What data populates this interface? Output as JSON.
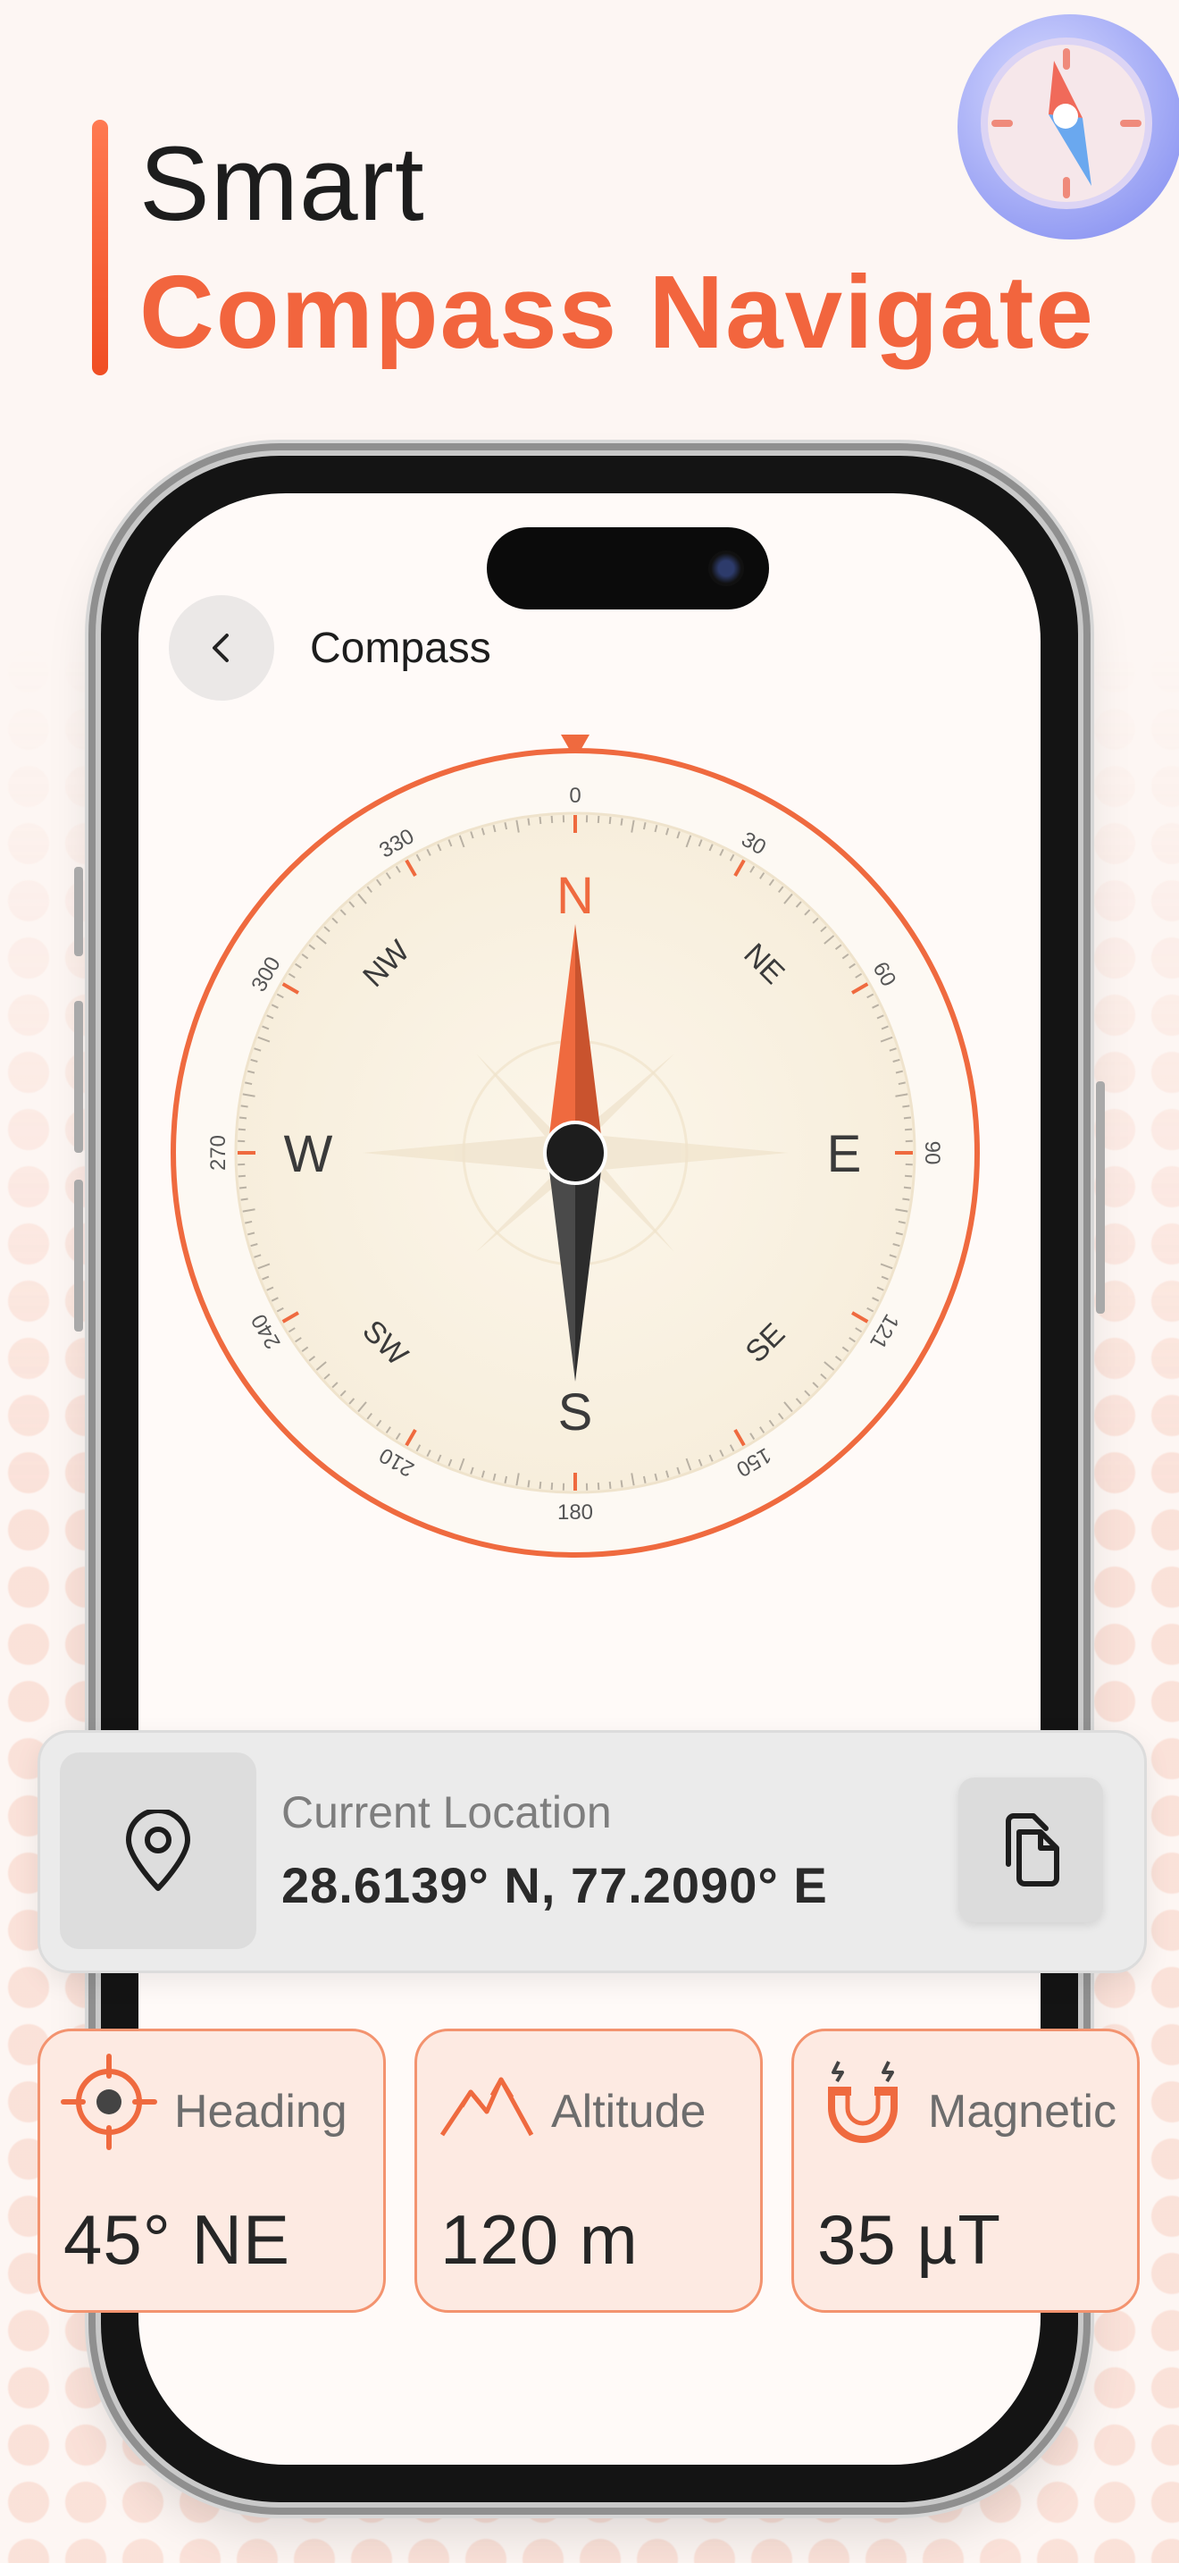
{
  "hero": {
    "line1": "Smart",
    "line2": "Compass Navigate"
  },
  "header": {
    "title": "Compass"
  },
  "compass": {
    "cardinals": {
      "n": "N",
      "e": "E",
      "s": "S",
      "w": "W"
    },
    "intercardinals": {
      "ne": "NE",
      "se": "SE",
      "sw": "SW",
      "nw": "NW"
    },
    "degree_labels": [
      "0",
      "30",
      "60",
      "90",
      "121",
      "150",
      "180",
      "210",
      "240",
      "270",
      "300",
      "330"
    ],
    "accent_color": "#ef6a3f"
  },
  "location": {
    "label": "Current Location",
    "coordinates": "28.6139° N, 77.2090° E"
  },
  "stats": [
    {
      "label": "Heading",
      "value": "45° NE",
      "icon": "crosshair-icon"
    },
    {
      "label": "Altitude",
      "value": "120 m",
      "icon": "mountain-icon"
    },
    {
      "label": "Magnetic",
      "value": "35 µT",
      "icon": "magnet-icon"
    }
  ]
}
